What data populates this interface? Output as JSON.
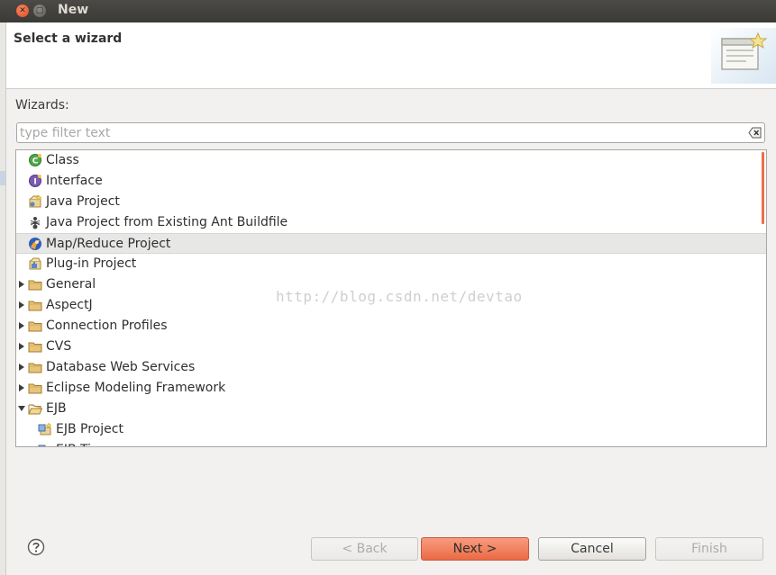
{
  "window": {
    "title": "New"
  },
  "header": {
    "title": "Select a wizard"
  },
  "wizards_label": "Wizards:",
  "filter": {
    "placeholder": "type filter text",
    "value": ""
  },
  "tree": [
    {
      "label": "Class",
      "icon": "java-class-icon",
      "expandable": false,
      "indent": 0
    },
    {
      "label": "Interface",
      "icon": "java-interface-icon",
      "expandable": false,
      "indent": 0
    },
    {
      "label": "Java Project",
      "icon": "java-project-icon",
      "expandable": false,
      "indent": 0
    },
    {
      "label": "Java Project from Existing Ant Buildfile",
      "icon": "ant-icon",
      "expandable": false,
      "indent": 0
    },
    {
      "label": "Map/Reduce Project",
      "icon": "mapreduce-icon",
      "expandable": false,
      "indent": 0,
      "selected": true
    },
    {
      "label": "Plug-in Project",
      "icon": "plugin-project-icon",
      "expandable": false,
      "indent": 0
    },
    {
      "label": "General",
      "icon": "folder-icon",
      "expandable": true,
      "expanded": false,
      "indent": 0
    },
    {
      "label": "AspectJ",
      "icon": "folder-icon",
      "expandable": true,
      "expanded": false,
      "indent": 0
    },
    {
      "label": "Connection Profiles",
      "icon": "folder-icon",
      "expandable": true,
      "expanded": false,
      "indent": 0
    },
    {
      "label": "CVS",
      "icon": "folder-icon",
      "expandable": true,
      "expanded": false,
      "indent": 0
    },
    {
      "label": "Database Web Services",
      "icon": "folder-icon",
      "expandable": true,
      "expanded": false,
      "indent": 0
    },
    {
      "label": "Eclipse Modeling Framework",
      "icon": "folder-icon",
      "expandable": true,
      "expanded": false,
      "indent": 0
    },
    {
      "label": "EJB",
      "icon": "folder-open-icon",
      "expandable": true,
      "expanded": true,
      "indent": 0
    },
    {
      "label": "EJB Project",
      "icon": "ejb-project-icon",
      "expandable": false,
      "indent": 1
    },
    {
      "label": "EJB Ti...",
      "icon": "ejb-timer-icon",
      "expandable": false,
      "indent": 1,
      "partial": true
    }
  ],
  "watermark": "http://blog.csdn.net/devtao",
  "buttons": {
    "back": "< Back",
    "next": "Next >",
    "cancel": "Cancel",
    "finish": "Finish"
  },
  "colors": {
    "accent": "#eb6a45",
    "selected_row": "#e7e7e6"
  }
}
